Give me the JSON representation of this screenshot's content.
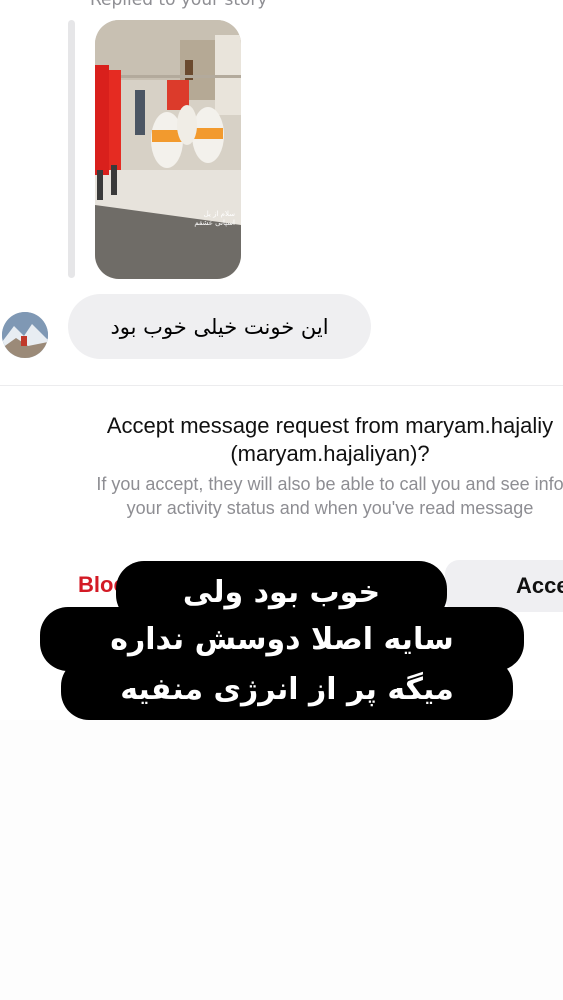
{
  "thread": {
    "replied_label": "Replied to your story",
    "message_text": "این خونت خیلی خوب بود"
  },
  "request": {
    "title_line1": "Accept message request from maryam.hajaliy",
    "title_line2": "(maryam.hajaliyan)?",
    "subtitle_line1": "If you accept, they will also be able to call you and see info",
    "subtitle_line2": "your activity status and when you've read message",
    "block_label": "Block",
    "accept_label": "Accept"
  },
  "story_overlay": {
    "caption_line1": "سلام از یل",
    "caption_line2": "اسپانی عشقم"
  },
  "caption": {
    "line1": "خوب بود ولی",
    "line2": "سایه اصلا دوسش نداره",
    "line3": "میگه پر از انرژی منفیه"
  },
  "colors": {
    "block_red": "#d31a25",
    "bubble_gray": "#efeff1",
    "caption_bg": "#000000"
  }
}
